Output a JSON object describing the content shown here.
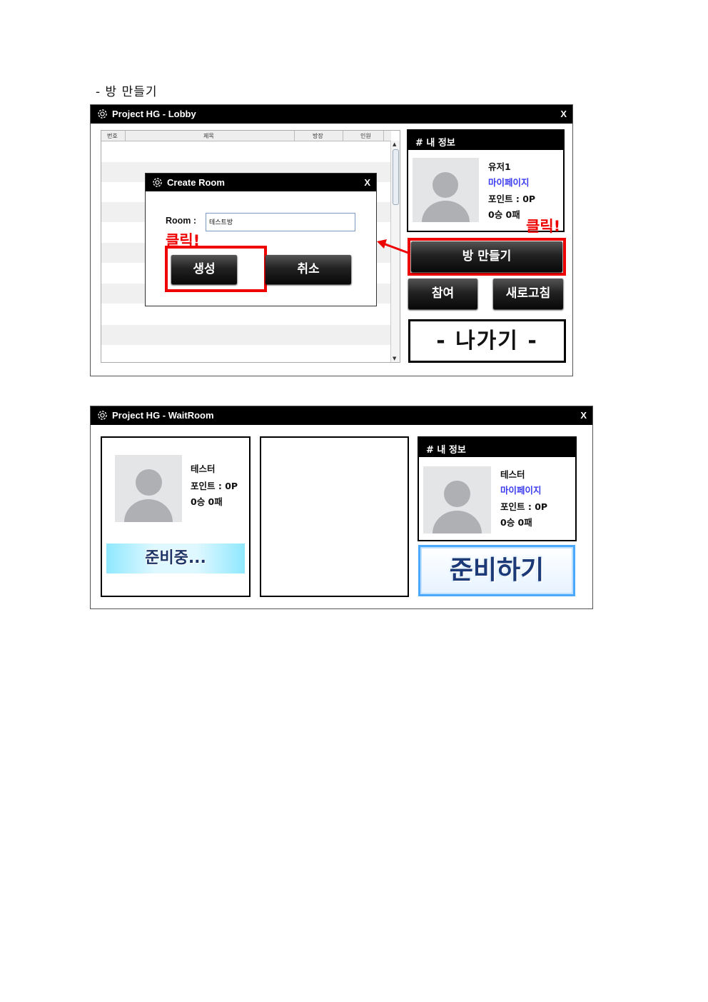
{
  "heading": "- 방 만들기",
  "lobby": {
    "title": "Project HG - Lobby",
    "close": "X",
    "columns": [
      "번호",
      "제목",
      "방장",
      "인원"
    ],
    "scroll_up": "▲",
    "scroll_down": "▼",
    "info_header": "# 내 정보",
    "user_name": "유저1",
    "mypage": "마이페이지",
    "points": "포인트 : 0P",
    "record": "0승 0패",
    "click_right": "클릭!",
    "create_room_btn": "방 만들기",
    "join_btn": "참여",
    "refresh_btn": "새로고침",
    "exit_btn": "- 나가기 -"
  },
  "create_room": {
    "title": "Create Room",
    "close": "X",
    "room_label": "Room :",
    "room_value": "테스트방",
    "click_left": "클릭!",
    "create_btn": "생성",
    "cancel_btn": "취소"
  },
  "waitroom": {
    "title": "Project HG - WaitRoom",
    "close": "X",
    "player_name": "테스터",
    "player_points": "포인트 : 0P",
    "player_record": "0승 0패",
    "player_status": "준비중...",
    "info_header": "# 내 정보",
    "my_name": "테스터",
    "mypage": "마이페이지",
    "my_points": "포인트 : 0P",
    "my_record": "0승 0패",
    "ready_btn": "준비하기"
  },
  "colors": {
    "accent_red": "#e00000",
    "link_blue": "#3b3bf0",
    "ready_blue": "#4aa8ff"
  }
}
